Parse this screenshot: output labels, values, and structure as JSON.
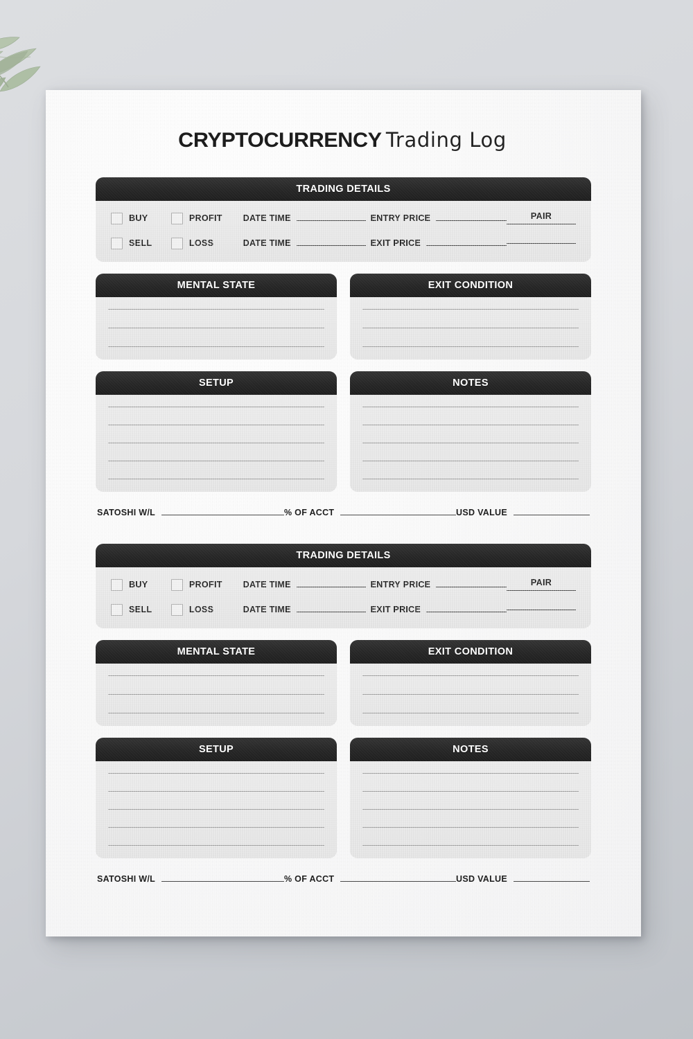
{
  "page": {
    "title_bold": "CRYPTOCURRENCY",
    "title_script": "Trading Log",
    "accent_dark": "#262626",
    "panel_gray": "#e8e8e8",
    "paper_white": "#fbfbfb",
    "background_gray": "#d4d7db",
    "leaf_green": "#a7b79c"
  },
  "labels": {
    "trading_details": "TRADING DETAILS",
    "mental_state": "MENTAL STATE",
    "exit_condition": "EXIT CONDITION",
    "setup": "SETUP",
    "notes": "NOTES",
    "buy": "BUY",
    "sell": "SELL",
    "profit": "PROFIT",
    "loss": "LOSS",
    "date_time": "DATE TIME",
    "entry_price": "ENTRY PRICE",
    "exit_price": "EXIT PRICE",
    "pair": "PAIR",
    "satoshi_wl": "SATOSHI W/L",
    "percent_of_acct": "% OF ACCT",
    "usd_value": "USD VALUE"
  },
  "entries": [
    {
      "details_title": "TRADING DETAILS",
      "row1": {
        "checkbox_a": "BUY",
        "checkbox_b": "PROFIT",
        "date_label": "DATE TIME",
        "price_label": "ENTRY PRICE",
        "pair_label": "PAIR",
        "date_value": "",
        "price_value": "",
        "pair_value": ""
      },
      "row2": {
        "checkbox_a": "SELL",
        "checkbox_b": "LOSS",
        "date_label": "DATE TIME",
        "price_label": "EXIT PRICE",
        "date_value": "",
        "price_value": "",
        "pair_value": ""
      },
      "mental_state": {
        "title": "MENTAL STATE",
        "line_count": 3,
        "lines": [
          "",
          "",
          ""
        ]
      },
      "exit_condition": {
        "title": "EXIT CONDITION",
        "line_count": 3,
        "lines": [
          "",
          "",
          ""
        ]
      },
      "setup": {
        "title": "SETUP",
        "line_count": 5,
        "lines": [
          "",
          "",
          "",
          "",
          ""
        ]
      },
      "notes": {
        "title": "NOTES",
        "line_count": 5,
        "lines": [
          "",
          "",
          "",
          "",
          ""
        ]
      },
      "summary": {
        "satoshi_label": "SATOSHI W/L",
        "satoshi_value": "",
        "acct_label": "% OF ACCT",
        "acct_value": "",
        "usd_label": "USD VALUE",
        "usd_value": ""
      }
    },
    {
      "details_title": "TRADING DETAILS",
      "row1": {
        "checkbox_a": "BUY",
        "checkbox_b": "PROFIT",
        "date_label": "DATE TIME",
        "price_label": "ENTRY PRICE",
        "pair_label": "PAIR",
        "date_value": "",
        "price_value": "",
        "pair_value": ""
      },
      "row2": {
        "checkbox_a": "SELL",
        "checkbox_b": "LOSS",
        "date_label": "DATE TIME",
        "price_label": "EXIT PRICE",
        "date_value": "",
        "price_value": "",
        "pair_value": ""
      },
      "mental_state": {
        "title": "MENTAL STATE",
        "line_count": 3,
        "lines": [
          "",
          "",
          ""
        ]
      },
      "exit_condition": {
        "title": "EXIT CONDITION",
        "line_count": 3,
        "lines": [
          "",
          "",
          ""
        ]
      },
      "setup": {
        "title": "SETUP",
        "line_count": 5,
        "lines": [
          "",
          "",
          "",
          "",
          ""
        ]
      },
      "notes": {
        "title": "NOTES",
        "line_count": 5,
        "lines": [
          "",
          "",
          "",
          "",
          ""
        ]
      },
      "summary": {
        "satoshi_label": "SATOSHI W/L",
        "satoshi_value": "",
        "acct_label": "% OF ACCT",
        "acct_value": "",
        "usd_label": "USD VALUE",
        "usd_value": ""
      }
    }
  ]
}
